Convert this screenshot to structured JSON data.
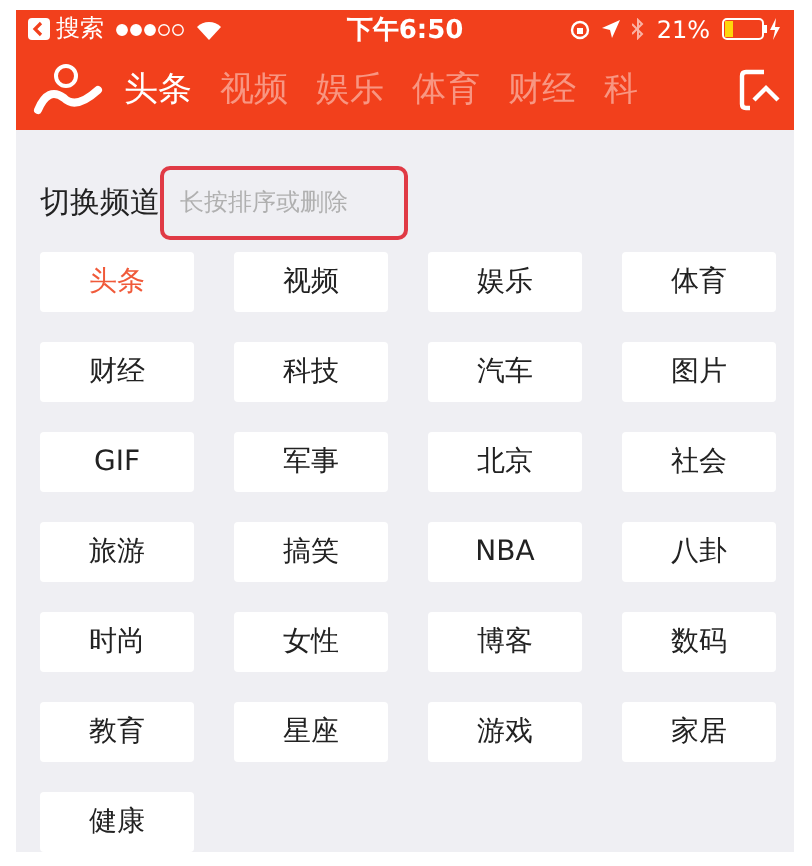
{
  "status_bar": {
    "back_label": "搜索",
    "time": "下午6:50",
    "battery": "21%"
  },
  "tabs": [
    {
      "label": "头条",
      "selected": true
    },
    {
      "label": "视频",
      "selected": false
    },
    {
      "label": "娱乐",
      "selected": false
    },
    {
      "label": "体育",
      "selected": false
    },
    {
      "label": "财经",
      "selected": false
    },
    {
      "label": "科",
      "selected": false
    }
  ],
  "panel": {
    "title": "切换频道",
    "hint": "长按排序或删除"
  },
  "channels": [
    {
      "label": "头条",
      "selected": true
    },
    {
      "label": "视频",
      "selected": false
    },
    {
      "label": "娱乐",
      "selected": false
    },
    {
      "label": "体育",
      "selected": false
    },
    {
      "label": "财经",
      "selected": false
    },
    {
      "label": "科技",
      "selected": false
    },
    {
      "label": "汽车",
      "selected": false
    },
    {
      "label": "图片",
      "selected": false
    },
    {
      "label": "GIF",
      "selected": false
    },
    {
      "label": "军事",
      "selected": false
    },
    {
      "label": "北京",
      "selected": false
    },
    {
      "label": "社会",
      "selected": false
    },
    {
      "label": "旅游",
      "selected": false
    },
    {
      "label": "搞笑",
      "selected": false
    },
    {
      "label": "NBA",
      "selected": false
    },
    {
      "label": "八卦",
      "selected": false
    },
    {
      "label": "时尚",
      "selected": false
    },
    {
      "label": "女性",
      "selected": false
    },
    {
      "label": "博客",
      "selected": false
    },
    {
      "label": "数码",
      "selected": false
    },
    {
      "label": "教育",
      "selected": false
    },
    {
      "label": "星座",
      "selected": false
    },
    {
      "label": "游戏",
      "selected": false
    },
    {
      "label": "家居",
      "selected": false
    },
    {
      "label": "健康",
      "selected": false
    }
  ]
}
